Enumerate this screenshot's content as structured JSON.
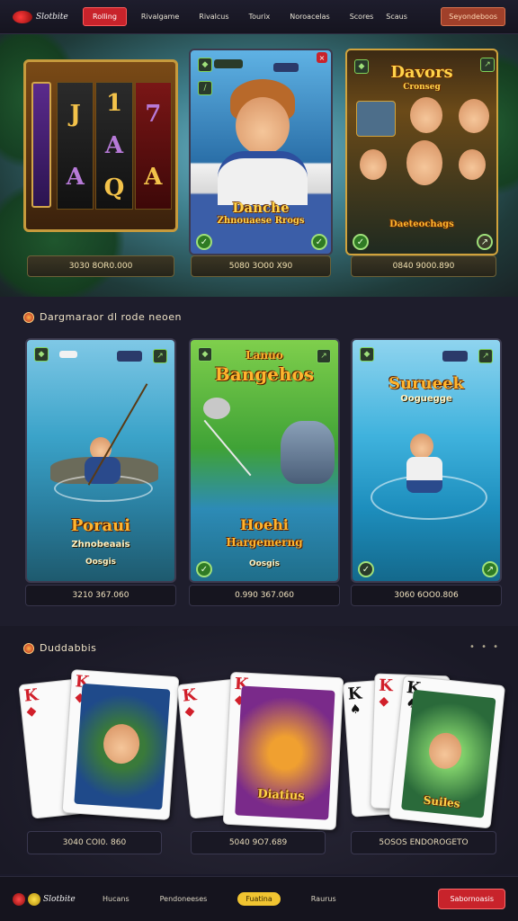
{
  "topbar": {
    "logo_text": "Slotbite",
    "primary_nav": "Rolling",
    "nav_items": [
      "Rivalgame",
      "Rivalcus",
      "Tourix",
      "Noroacelas",
      "Scores",
      "Scaus"
    ],
    "cta": "Seyondeboos"
  },
  "hero": {
    "cards": [
      {
        "title": "",
        "price": "3030 8OR0.000"
      },
      {
        "title": "Danche",
        "subtitle": "Zhnouaese Rrogs",
        "price": "5080 3O00 X90"
      },
      {
        "title": "Davors",
        "subtitle": "Cronseg",
        "banner": "Daeteochags",
        "price": "0840 9000.890"
      }
    ]
  },
  "section_two": {
    "heading": "Dargmaraor dl rode neoen",
    "tiles": [
      {
        "title": "Poraui",
        "subtitle": "Zhnobeaais",
        "tag": "Oosgis",
        "price": "3210 367.060"
      },
      {
        "title": "Lanuo",
        "title2": "Bangehos",
        "subtitle": "Hoehi",
        "subtitle2": "Hargemerng",
        "tag": "Oosgis",
        "price": "0.990 367.060"
      },
      {
        "title": "Surueek",
        "subtitle": "Ooguegge",
        "price": "3060 6OO0.806"
      }
    ]
  },
  "section_three": {
    "heading": "Duddabbis",
    "menu_dots": "• • •",
    "groups": [
      {
        "ranks": [
          "K",
          "K"
        ],
        "price": "3040 COI0. 860"
      },
      {
        "ranks": [
          "K",
          "K"
        ],
        "art_label": "Diatius",
        "price": "5040 9O7.689"
      },
      {
        "ranks": [
          "K",
          "K",
          "K"
        ],
        "art_label": "Suiles",
        "price": "5OSOS ENDOROGETO"
      }
    ]
  },
  "bottombar": {
    "logo_text": "Slotbite",
    "items": [
      "Hucans",
      "Pendoneeses",
      "Raurus"
    ],
    "pill": "Fuatina",
    "cta": "Sabornoasis"
  },
  "colors": {
    "accent_red": "#c8232b",
    "gold": "#f0c431",
    "bg": "#1b1a2b"
  }
}
